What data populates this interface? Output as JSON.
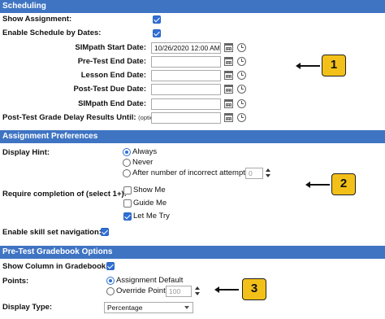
{
  "sections": {
    "scheduling": {
      "title": "Scheduling",
      "show_assignment": {
        "label": "Show Assignment:",
        "checked": true
      },
      "enable_schedule": {
        "label": "Enable Schedule by Dates:",
        "checked": true
      },
      "simpath_start": {
        "label": "SIMpath Start Date:",
        "value": "10/26/2020 12:00 AM"
      },
      "pretest_end": {
        "label": "Pre-Test End Date:",
        "value": ""
      },
      "lesson_end": {
        "label": "Lesson End Date:",
        "value": ""
      },
      "posttest_due": {
        "label": "Post-Test Due Date:",
        "value": ""
      },
      "simpath_end": {
        "label": "SIMpath End Date:",
        "value": ""
      },
      "grade_delay": {
        "label": "Post-Test Grade Delay Results Until:",
        "optional": "(optional)",
        "value": ""
      }
    },
    "preferences": {
      "title": "Assignment Preferences",
      "display_hint": {
        "label": "Display Hint:",
        "options": [
          "Always",
          "Never",
          "After number of incorrect attempts"
        ],
        "selected": "Always",
        "attempts_value": "0"
      },
      "require_completion": {
        "label": "Require completion of (select 1+):",
        "options": [
          {
            "label": "Show Me",
            "checked": false
          },
          {
            "label": "Guide Me",
            "checked": false
          },
          {
            "label": "Let Me Try",
            "checked": true
          }
        ]
      },
      "skill_nav": {
        "label": "Enable skill set navigation:",
        "checked": true
      }
    },
    "gradebook": {
      "title": "Pre-Test Gradebook Options",
      "show_column": {
        "label": "Show Column in Gradebook:",
        "checked": true
      },
      "points": {
        "label": "Points:",
        "options": [
          "Assignment Default",
          "Override Points"
        ],
        "selected": "Assignment Default",
        "override_value": "100"
      },
      "display_type": {
        "label": "Display Type:",
        "value": "Percentage"
      }
    }
  },
  "callouts": [
    "1",
    "2",
    "3"
  ],
  "colors": {
    "header_bg": "#3f74c3",
    "checkbox": "#2f6fd6",
    "callout_bg": "#f2c019"
  },
  "icons": [
    "calendar-icon",
    "clock-icon",
    "checkbox-checked-icon",
    "radio-icon",
    "spinner-icon",
    "dropdown-caret-icon",
    "arrow-left-icon"
  ]
}
